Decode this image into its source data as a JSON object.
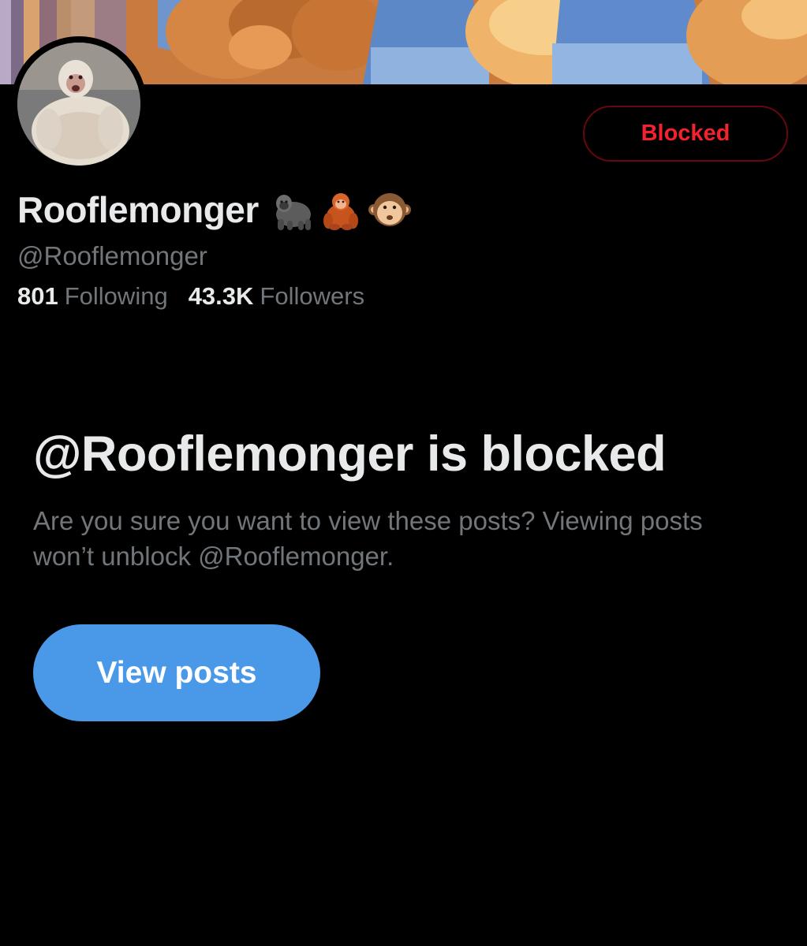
{
  "profile": {
    "banner_icon": "pixel-art-banner",
    "avatar_icon": "monkey-avatar",
    "display_name": "Rooflemonger",
    "badges": [
      "gorilla-emoji-icon",
      "orangutan-emoji-icon",
      "monkey-face-emoji-icon"
    ],
    "handle": "@Rooflemonger",
    "following_count": "801",
    "following_label": "Following",
    "followers_count": "43.3K",
    "followers_label": "Followers"
  },
  "actions": {
    "blocked_label": "Blocked",
    "view_posts_label": "View posts"
  },
  "notice": {
    "title": "@Rooflemonger is blocked",
    "description": "Are you sure you want to view these posts? Viewing posts won’t unblock @Rooflemonger."
  },
  "colors": {
    "background": "#000000",
    "primary_text": "#e7e9ea",
    "secondary_text": "#71767b",
    "blocked_red": "#f4212e",
    "blocked_border": "#67070f",
    "accent_blue": "#4a99e9"
  }
}
